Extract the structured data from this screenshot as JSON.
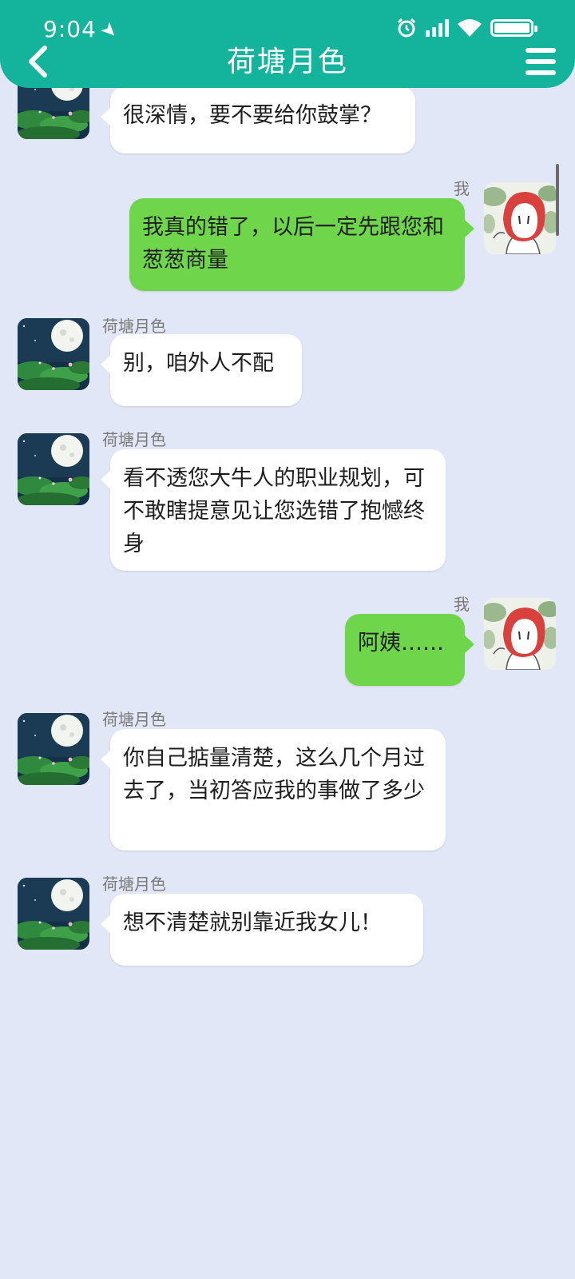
{
  "status_bar": {
    "time": "9:04"
  },
  "header": {
    "title": "荷塘月色"
  },
  "icons": {
    "back": "chevron-left-icon",
    "menu": "hamburger-menu-icon",
    "location": "location-arrow-icon",
    "alarm": "alarm-clock-icon",
    "signal": "cellular-signal-icon",
    "wifi": "wifi-icon",
    "battery": "battery-icon"
  },
  "colors": {
    "header": "#14b39b",
    "background": "#e2e7f8",
    "outgoing_bubble": "#6fd54a",
    "incoming_bubble": "#ffffff"
  },
  "messages": [
    {
      "side": "left",
      "sender": "",
      "text": "很深情，要不要给你鼓掌？"
    },
    {
      "side": "right",
      "sender": "我",
      "text": "我真的错了，以后一定先跟您和葱葱商量"
    },
    {
      "side": "left",
      "sender": "荷塘月色",
      "text": "别，咱外人不配"
    },
    {
      "side": "left",
      "sender": "荷塘月色",
      "text": "看不透您大牛人的职业规划，可不敢瞎提意见让您选错了抱憾终身"
    },
    {
      "side": "right",
      "sender": "我",
      "text": "阿姨……"
    },
    {
      "side": "left",
      "sender": "荷塘月色",
      "text": "你自己掂量清楚，这么几个月过去了，当初答应我的事做了多少"
    },
    {
      "side": "left",
      "sender": "荷塘月色",
      "text": "想不清楚就别靠近我女儿！"
    }
  ]
}
